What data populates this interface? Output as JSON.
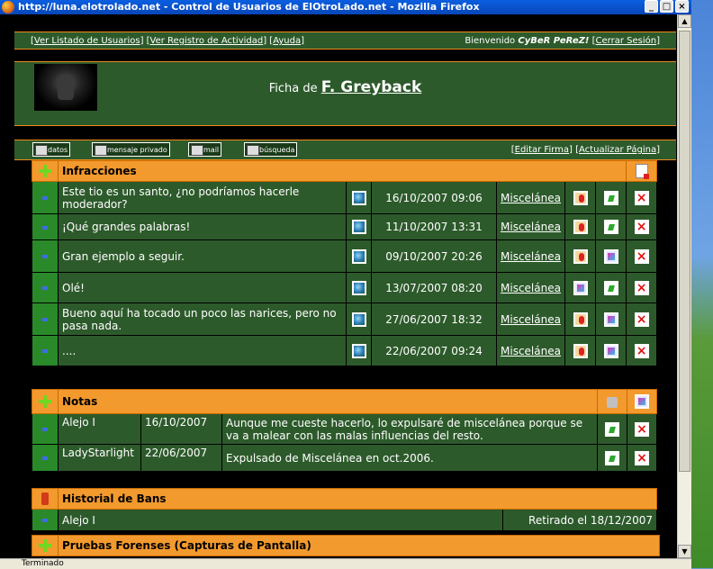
{
  "window": {
    "title": "http://luna.elotrolado.net - Control de Usuarios de ElOtroLado.net - Mozilla Firefox",
    "status": "Terminado"
  },
  "topbar": {
    "links": [
      "Ver Listado de Usuarios",
      "Ver Registro de Actividad",
      "Ayuda"
    ],
    "welcome": "Bienvenido",
    "user": "CyBeR PeReZ!",
    "logout": "Cerrar Sesión"
  },
  "header": {
    "prefix": "Ficha de",
    "name": "F. Greyback"
  },
  "toolbar": {
    "buttons": [
      "datos",
      "mensaje privado",
      "mail",
      "búsqueda"
    ],
    "links": [
      "Editar Firma",
      "Actualizar Página"
    ]
  },
  "infracciones": {
    "title": "Infracciones",
    "rows": [
      {
        "text": "Este tio es un santo, ¿no podríamos hacerle moderador?",
        "date": "16/10/2007 09:06",
        "forum": "Miscelánea"
      },
      {
        "text": "¡Qué grandes palabras!",
        "date": "11/10/2007 13:31",
        "forum": "Miscelánea"
      },
      {
        "text": "Gran ejemplo a seguir.",
        "date": "09/10/2007 20:26",
        "forum": "Miscelánea"
      },
      {
        "text": "Olé!",
        "date": "13/07/2007 08:20",
        "forum": "Miscelánea"
      },
      {
        "text": "Bueno aquí ha tocado un poco las narices, pero no pasa nada.",
        "date": "27/06/2007 18:32",
        "forum": "Miscelánea"
      },
      {
        "text": "....",
        "date": "22/06/2007 09:24",
        "forum": "Miscelánea"
      }
    ]
  },
  "notas": {
    "title": "Notas",
    "rows": [
      {
        "author": "Alejo I",
        "date": "16/10/2007",
        "text": "Aunque me cueste hacerlo, lo expulsaré de miscelánea porque se va a malear con las malas influencias del resto."
      },
      {
        "author": "LadyStarlight",
        "date": "22/06/2007",
        "text": "Expulsado de Miscelánea en oct.2006."
      }
    ]
  },
  "bans": {
    "title": "Historial de Bans",
    "rows": [
      {
        "author": "Alejo I",
        "status": "Retirado el 18/12/2007"
      }
    ]
  },
  "forenses": {
    "title": "Pruebas Forenses (Capturas de Pantalla)"
  }
}
